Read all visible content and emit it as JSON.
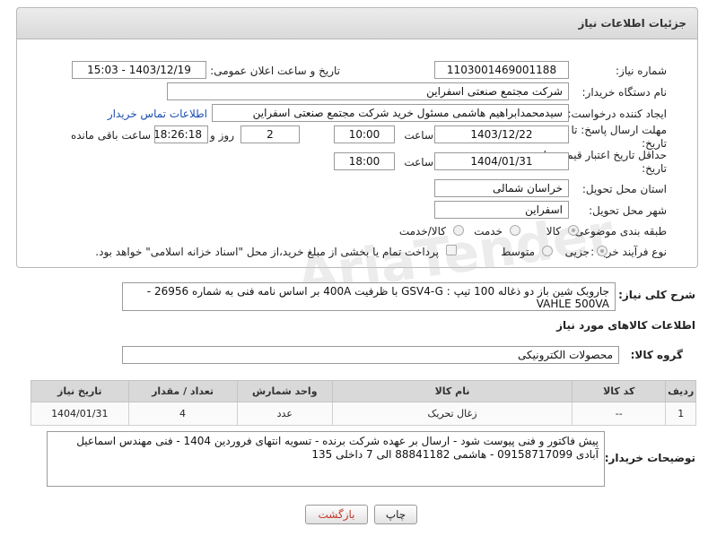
{
  "panel": {
    "title": "جزئیات اطلاعات نیاز"
  },
  "fields": {
    "need_number_label": "شماره نیاز:",
    "need_number": "1103001469001188",
    "announce_label": "تاریخ و ساعت اعلان عمومی:",
    "announce_value": "1403/12/19 - 15:03",
    "buyer_label": "نام دستگاه خریدار:",
    "buyer_value": "شرکت مجتمع صنعتی اسفراین",
    "creator_label": "ایجاد کننده درخواست:",
    "creator_value": "سیدمحمدابراهیم هاشمی مسئول خرید شرکت مجتمع صنعتی اسفراین",
    "contact_link": "اطلاعات تماس خریدار",
    "deadline_label": "مهلت ارسال پاسخ: تا تاریخ:",
    "deadline_date": "1403/12/22",
    "time_label": "ساعت",
    "deadline_time": "10:00",
    "days_value": "2",
    "days_label": "روز و",
    "remaining_time": "18:26:18",
    "remaining_label": "ساعت باقی مانده",
    "validity_label": "حداقل تاریخ اعتبار قیمت: تا تاریخ:",
    "validity_date": "1404/01/31",
    "validity_time": "18:00",
    "province_label": "استان محل تحویل:",
    "province_value": "خراسان شمالی",
    "city_label": "شهر محل تحویل:",
    "city_value": "اسفراین",
    "category_label": "طبقه بندی موضوعی:",
    "category_options": [
      "کالا",
      "خدمت",
      "کالا/خدمت"
    ],
    "process_label": "نوع فرآیند خرید :",
    "process_options": [
      "جزیی",
      "متوسط"
    ],
    "payment_note": "پرداخت تمام یا بخشی از مبلغ خرید،از محل \"اسناد خزانه اسلامی\" خواهد بود."
  },
  "summary": {
    "label": "شرح کلی نیاز:",
    "value": "جاروبک شین باز دو ذغاله 100 تیپ : GSV4-G با ظرفیت 400A بر اساس نامه فنی به شماره 26956 - VAHLE 500VA"
  },
  "goods": {
    "section_title": "اطلاعات کالاهای مورد نیاز",
    "group_label": "گروه کالا:",
    "group_value": "محصولات الکترونیکی",
    "columns": [
      "ردیف",
      "کد کالا",
      "نام کالا",
      "واحد شمارش",
      "تعداد / مقدار",
      "تاریخ نیاز"
    ],
    "rows": [
      [
        "1",
        "--",
        "زغال تحریک",
        "عدد",
        "4",
        "1404/01/31"
      ]
    ]
  },
  "buyer_notes": {
    "label": "توضیحات خریدار:",
    "value": "پیش فاکتور و فنی پیوست شود - ارسال بر عهده شرکت برنده - تسویه انتهای فروردین 1404 - فنی مهندس اسماعیل آبادی 09158717099 - هاشمی 88841182 الی 7 داخلی 135"
  },
  "buttons": {
    "print": "چاپ",
    "back": "بازگشت"
  }
}
